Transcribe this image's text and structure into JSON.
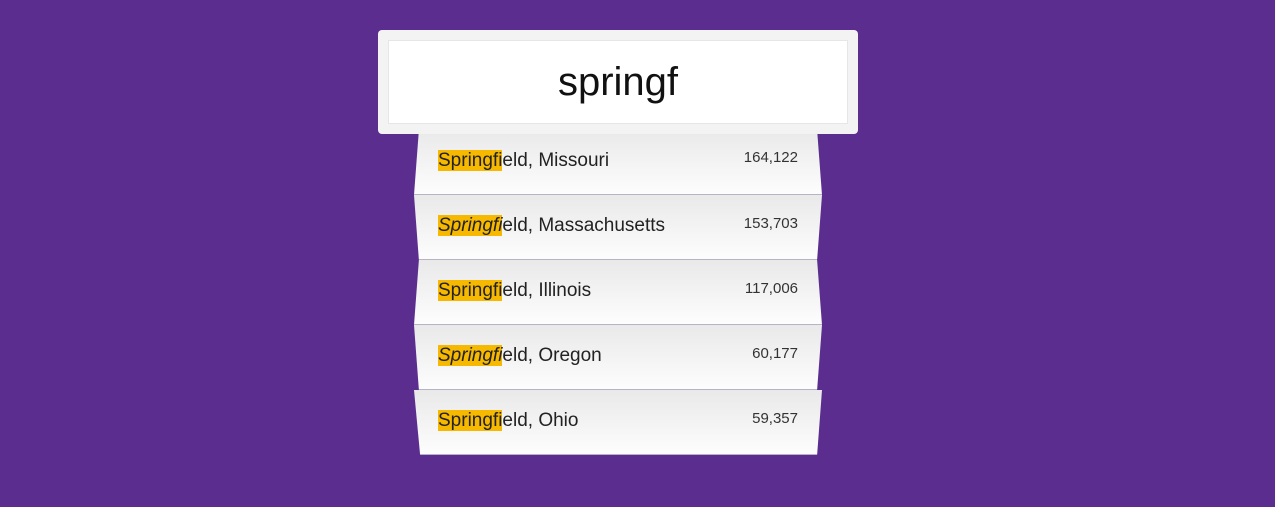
{
  "search": {
    "value": "springf",
    "placeholder": ""
  },
  "results": [
    {
      "match": "Springfi",
      "rest": "eld, Missouri",
      "population": "164,122",
      "italic": false
    },
    {
      "match": "Springfi",
      "rest": "eld, Massachusetts",
      "population": "153,703",
      "italic": true
    },
    {
      "match": "Springfi",
      "rest": "eld, Illinois",
      "population": "117,006",
      "italic": false
    },
    {
      "match": "Springfi",
      "rest": "eld, Oregon",
      "population": "60,177",
      "italic": true
    },
    {
      "match": "Springfi",
      "rest": "eld, Ohio",
      "population": "59,357",
      "italic": false
    }
  ],
  "colors": {
    "background": "#5b2d8e",
    "highlight": "#f6b900"
  }
}
